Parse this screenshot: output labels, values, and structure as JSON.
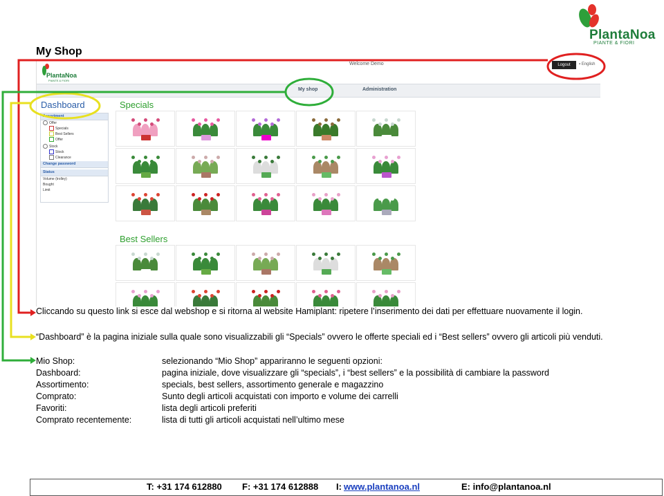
{
  "logo": {
    "brand": "PlantaNoa",
    "tagline": "PIANTE & FIORI"
  },
  "page_title": "My Shop",
  "screenshot": {
    "welcome": "Welcome Demo",
    "logout": "Logout",
    "language": "English",
    "mini_logo": {
      "brand": "PlantaNoa",
      "tagline": "PIANTE & FIORI"
    },
    "nav": {
      "my_shop": "My shop",
      "administration": "Administration"
    },
    "dashboard_title": "Dashboard",
    "sidebar": {
      "assortment_header": "Assortment",
      "offer": "Offer",
      "specials": "Specials",
      "best_sellers": "Best Sellers",
      "offer_sub": "Offer",
      "stock": "Stock",
      "stock_sub": "Stock",
      "clearance": "Clearance",
      "change_password": "Change password",
      "status_header": "Status",
      "volume": "Volume (trolley)",
      "bought": "Bought",
      "limit": "Limit"
    },
    "specials_title": "Specials",
    "best_sellers_title": "Best Sellers"
  },
  "annotations": {
    "red_text": "Cliccando su questo link si esce dal webshop e si ritorna al website Hamiplant: ripetere l’inserimento dei dati per effettuare nuovamente il login.",
    "yellow_text": "“Dashboard” è la pagina iniziale sulla quale sono visualizzabili gli “Specials” ovvero le offerte speciali ed i “Best sellers” ovvero gli articoli più venduti.",
    "items": [
      {
        "label": "Mio Shop:",
        "desc": "selezionando “Mio Shop” appariranno le seguenti opzioni:"
      },
      {
        "label": "Dashboard:",
        "desc": "pagina iniziale, dove visualizzare gli “specials”, i “best sellers” e la possibilità di cambiare la password"
      },
      {
        "label": "Assortimento:",
        "desc": "specials, best sellers, assortimento generale e magazzino"
      },
      {
        "label": "Comprato:",
        "desc": "Sunto degli articoli acquistati con importo e volume dei carrelli"
      },
      {
        "label": "Favoriti:",
        "desc": "lista degli articoli preferiti"
      },
      {
        "label": "Comprato recentemente:",
        "desc": "lista di tutti gli articoli acquistati nell’ultimo mese"
      }
    ]
  },
  "footer": {
    "tel": "T: +31 174 612880",
    "fax": "F: +31 174 612888",
    "web_label": "I:",
    "web": "www.plantanoa.nl",
    "email": "E: info@plantanoa.nl"
  },
  "colors": {
    "red": "#e02020",
    "yellow": "#e8e020",
    "green": "#2fae3a",
    "brand_green": "#1e7d3a",
    "link_blue": "#2a5da8"
  }
}
